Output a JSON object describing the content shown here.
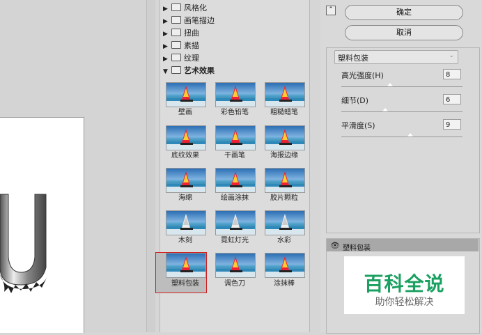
{
  "filter_categories": [
    {
      "label": "风格化",
      "expanded": false
    },
    {
      "label": "画笔描边",
      "expanded": false
    },
    {
      "label": "扭曲",
      "expanded": false
    },
    {
      "label": "素描",
      "expanded": false
    },
    {
      "label": "纹理",
      "expanded": false
    },
    {
      "label": "艺术效果",
      "expanded": true
    }
  ],
  "artistic_filters": [
    "壁画",
    "彩色铅笔",
    "粗糙蜡笔",
    "底纹效果",
    "干画笔",
    "海报边缘",
    "海绵",
    "绘画涂抹",
    "胶片颗粒",
    "木刻",
    "霓虹灯光",
    "水彩",
    "塑料包装",
    "调色刀",
    "涂抹棒"
  ],
  "selected_filter": "塑料包装",
  "buttons": {
    "ok": "确定",
    "cancel": "取消"
  },
  "settings": {
    "filter_select": "塑料包装",
    "params": [
      {
        "label": "高光强度(H)",
        "value": "8",
        "level": 0.4
      },
      {
        "label": "细节(D)",
        "value": "6",
        "level": 0.36
      },
      {
        "label": "平滑度(S)",
        "value": "9",
        "level": 0.57
      }
    ]
  },
  "layer": {
    "name": "塑料包装"
  },
  "watermark": {
    "main": "百科全说",
    "sub": "助你轻松解决"
  },
  "icons": [
    "triangle-right-icon",
    "triangle-down-icon",
    "folder-icon",
    "collapse-icon",
    "chevron-down-icon",
    "eye-icon"
  ]
}
